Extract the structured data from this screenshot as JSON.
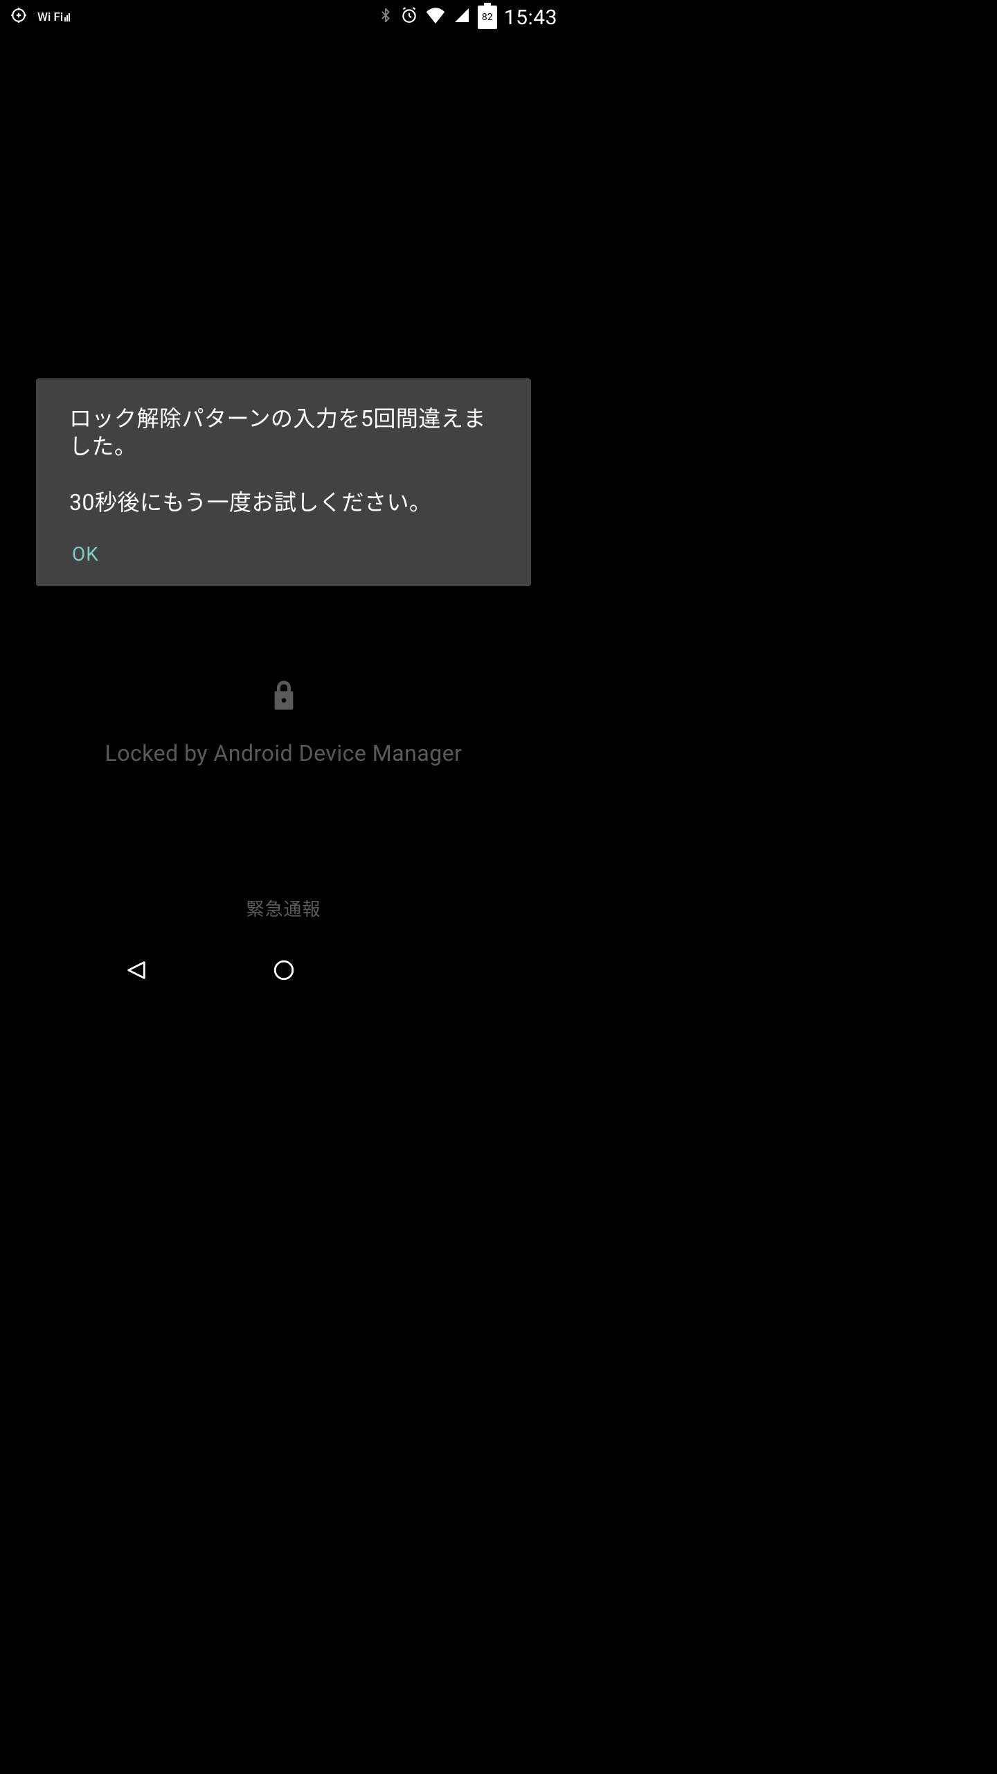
{
  "status_bar": {
    "wifi_label": "Wi Fi",
    "battery_percent": "82",
    "time": "15:43"
  },
  "dialog": {
    "message": "ロック解除パターンの入力を5回間違えました。\n\n30秒後にもう一度お試しください。",
    "ok_label": "OK"
  },
  "lock_screen": {
    "locked_by": "Locked by Android Device Manager",
    "emergency": "緊急通報"
  }
}
